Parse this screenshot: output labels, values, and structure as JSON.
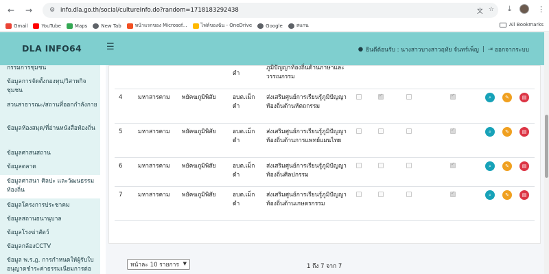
{
  "browser": {
    "url": "info.dla.go.th/social/cultureInfo.do?random=1718183292438",
    "bookmarks": [
      {
        "label": "Gmail",
        "color": "#ea4335"
      },
      {
        "label": "YouTube",
        "color": "#ff0000"
      },
      {
        "label": "Maps",
        "color": "#34a853"
      },
      {
        "label": "New Tab",
        "color": "#5f6368"
      },
      {
        "label": "หน้าแรกของ Microsof...",
        "color": "#f25022"
      },
      {
        "label": "ไฟล์ของฉัน - OneDrive",
        "color": "#ffb900"
      },
      {
        "label": "Google",
        "color": "#5f6368"
      },
      {
        "label": "สแกน",
        "color": "#5f6368"
      }
    ],
    "all_bookmarks": "All Bookmarks"
  },
  "header": {
    "brand": "DLA INFO64",
    "welcome": "ยินดีต้อนรับ : นางสาวบางสาวฤทัย จันทร์เพ็ญ",
    "logout": "ออกจากระบบ"
  },
  "sidebar": {
    "items": [
      "กรรมการชุมชน",
      "ข้อมูลการจัดตั้งกองทุน/วิสาหกิจชุมชน",
      "สวนสาธารณะ/สถานที่ออกกำลังกาย",
      "ข้อมูลห้องสมุด/ที่อ่านหนังสือท้องถิ่น",
      "ข้อมูลศาสนสถาน",
      "ข้อมูลตลาด",
      "ข้อมูลศาสนา ศิลปะ และวัฒนธรรมท้องถิ่น",
      "ข้อมูลโครงการประชาคม",
      "ข้อมูลสถานธนานุบาล",
      "ข้อมูลโรงฆ่าสัตว์",
      "ข้อมูลกล้องCCTV",
      "ข้อมูล พ.ร.ฎ. การกำหนดให้ผู้รับใบอนุญาตชำระค่าธรรมเนียมการต่ออายุใบอนุญาตแทนการ"
    ]
  },
  "table": {
    "partial_row": {
      "cols": [
        "ตำ",
        "ภูมิปัญญาท้องถิ่นด้านภาษาและวรรณกรรม"
      ]
    },
    "rows": [
      {
        "no": "4",
        "province": "มหาสารคาม",
        "district": "พยัคฆภูมิพิสัย",
        "org": "อบต.เม็กดำ",
        "desc": "ส่งเสริมศูนย์การเรียนรู้ภูมิปัญญาท้องถิ่นด้านหัตถกรรม",
        "checks": [
          false,
          true,
          false,
          true
        ]
      },
      {
        "no": "5",
        "province": "มหาสารคาม",
        "district": "พยัคฆภูมิพิสัย",
        "org": "อบต.เม็กดำ",
        "desc": "ส่งเสริมศูนย์การเรียนรู้ภูมิปัญญาท้องถิ่นด้านการแพทย์แผนไทย",
        "checks": [
          false,
          false,
          false,
          true
        ]
      },
      {
        "no": "6",
        "province": "มหาสารคาม",
        "district": "พยัคฆภูมิพิสัย",
        "org": "อบต.เม็กดำ",
        "desc": "ส่งเสริมศูนย์การเรียนรู้ภูมิปัญญาท้องถิ่นศิลปกรรม",
        "checks": [
          false,
          false,
          false,
          true
        ]
      },
      {
        "no": "7",
        "province": "มหาสารคาม",
        "district": "พยัคฆภูมิพิสัย",
        "org": "อบต.เม็กดำ",
        "desc": "ส่งเสริมศูนย์การเรียนรู้ภูมิปัญญาท้องถิ่นด้านเกษตรกรรม",
        "checks": [
          false,
          false,
          false,
          true
        ]
      }
    ]
  },
  "pager": {
    "page_size": "หน้าละ 10 รายการ",
    "info": "1 ถึง 7 จาก 7"
  },
  "colors": {
    "header": "#7fcfcf",
    "sidebar": "#e2f3f3",
    "view": "#17a2b8",
    "edit": "#f0a020",
    "delete": "#dc3545"
  }
}
